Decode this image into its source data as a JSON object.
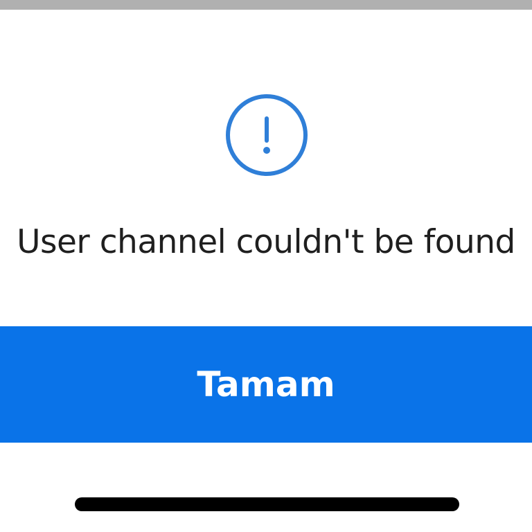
{
  "alert": {
    "icon": "exclamation-circle-icon",
    "accent_color": "#2f7fd8",
    "message": "User channel couldn't be found"
  },
  "actions": {
    "ok_label": "Tamam",
    "button_color": "#0a73e8"
  },
  "system": {
    "home_indicator": "home-indicator-bar"
  }
}
